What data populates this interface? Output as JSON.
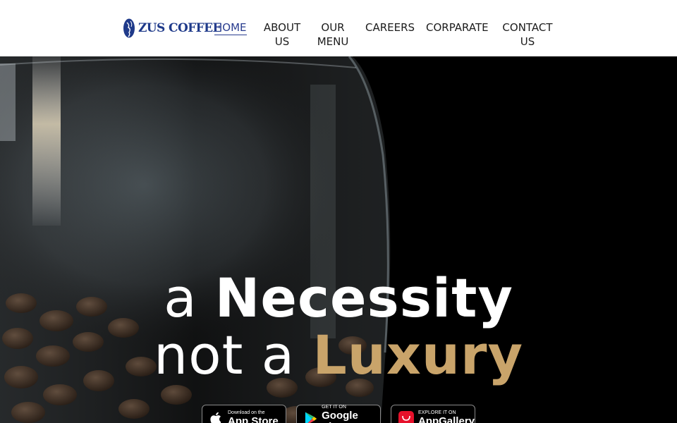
{
  "brand": {
    "logo_text": "ZUS COFFEE"
  },
  "nav": {
    "items": [
      {
        "label": "HOME",
        "active": true
      },
      {
        "label": "ABOUT\nUS",
        "active": false
      },
      {
        "label": "OUR\nMENU",
        "active": false
      },
      {
        "label": "CAREERS",
        "active": false
      },
      {
        "label": "CORPARATE",
        "active": false
      },
      {
        "label": "CONTACT\nUS",
        "active": false
      }
    ]
  },
  "hero": {
    "line1_light": "a ",
    "line1_bold": "Necessity",
    "line2_light": "not a ",
    "line2_bold": "Luxury"
  },
  "badges": {
    "apple": {
      "small": "Download on the",
      "big": "App Store",
      "icon": "apple-icon"
    },
    "google": {
      "small": "GET IT ON",
      "big": "Google Play",
      "icon": "google-play-icon"
    },
    "huawei": {
      "small": "EXPLORE IT ON",
      "big": "AppGallery",
      "icon": "huawei-appgallery-icon"
    }
  },
  "colors": {
    "brand_blue": "#1f3a8a",
    "accent_gold": "#c9a46a",
    "nav_text": "#1c1c1c"
  }
}
